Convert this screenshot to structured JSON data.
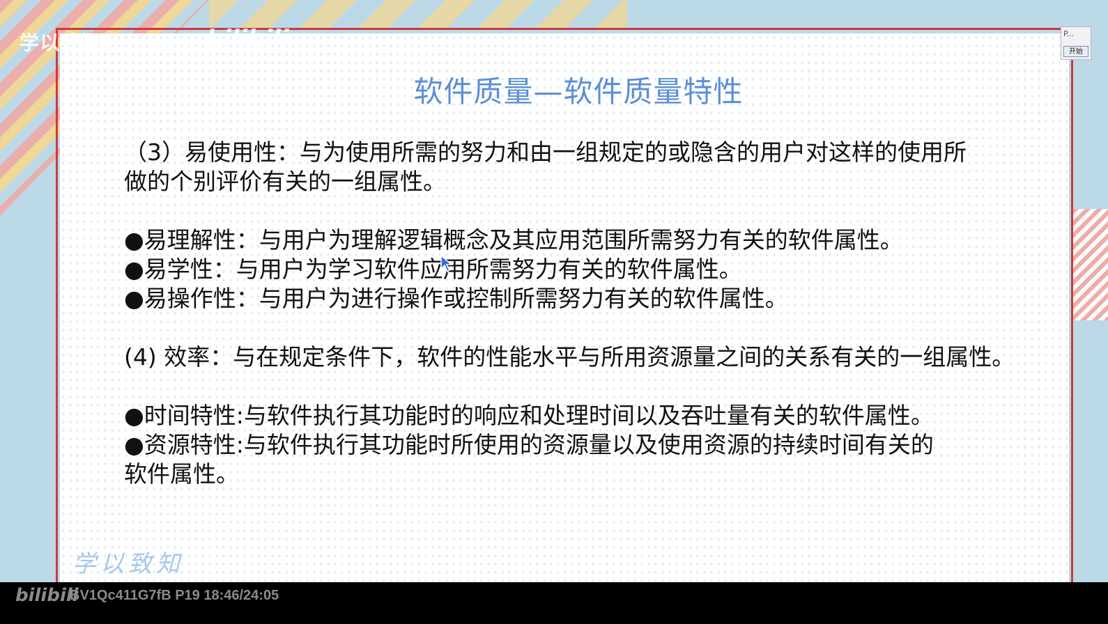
{
  "watermark": {
    "text": "学以致知Learning",
    "logo": "bilibili"
  },
  "slide": {
    "title": "软件质量—软件质量特性",
    "lines": [
      "（3）易使用性：与为使用所需的努力和由一组规定的或隐含的用户对这样的使用所",
      "做的个别评价有关的一组属性。",
      "●易理解性：与用户为理解逻辑概念及其应用范围所需努力有关的软件属性。",
      "●易学性：与用户为学习软件应用所需努力有关的软件属性。",
      "●易操作性：与用户为进行操作或控制所需努力有关的软件属性。",
      "(4) 效率：与在规定条件下，软件的性能水平与所用资源量之间的关系有关的一组属性。",
      "●时间特性:与软件执行其功能时的响应和处理时间以及吞吐量有关的软件属性。",
      "●资源特性:与软件执行其功能时所使用的资源量以及使用资源的持续时间有关的",
      "软件属性。"
    ],
    "signature": "学以致知"
  },
  "mini_widget": {
    "label": "P...",
    "button": "开始"
  },
  "bottom_bar": {
    "logo": "bilibili",
    "info": "BV1Qc411G7fB P19 18:46/24:05"
  },
  "colors": {
    "title": "#5b8fd6",
    "frame": "#cc3a3a",
    "background": "#bcd9e8"
  }
}
